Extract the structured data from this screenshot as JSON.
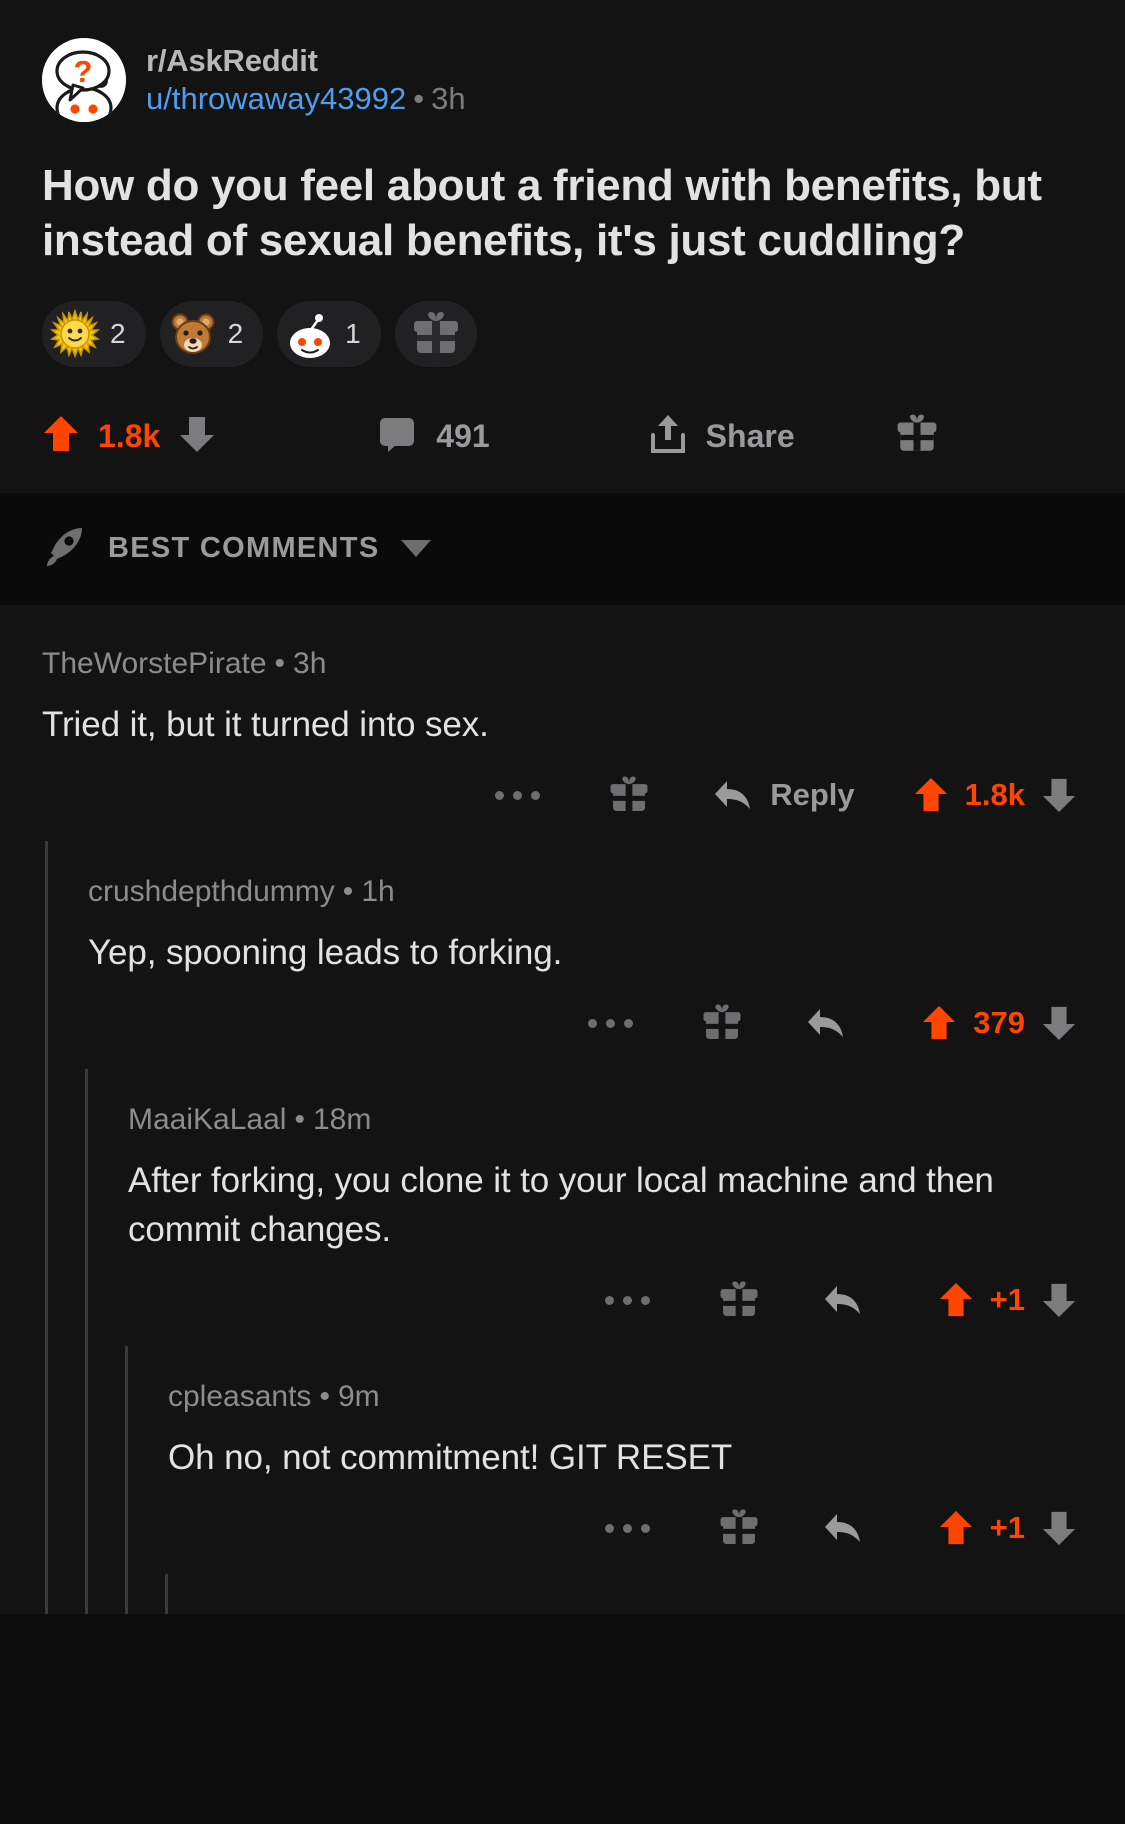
{
  "post": {
    "subreddit": "r/AskReddit",
    "author": "u/throwaway43992",
    "separator": "•",
    "age": "3h",
    "avatar_icon": "askreddit-snoo-avatar",
    "title": "How do you feel about a friend with benefits, but instead of sexual benefits, it's just cuddling?",
    "awards": [
      {
        "icon": "gold-starburst-face-award-icon",
        "count": "2"
      },
      {
        "icon": "bear-award-icon",
        "count": "2"
      },
      {
        "icon": "snoo-award-icon",
        "count": "1"
      },
      {
        "icon": "give-award-gift-icon",
        "count": ""
      }
    ],
    "actions": {
      "upvote_icon": "upvote-arrow-icon",
      "score": "1.8k",
      "downvote_icon": "downvote-arrow-icon",
      "comment_icon": "comment-bubble-icon",
      "comment_count": "491",
      "share_icon": "share-arrow-icon",
      "share_label": "Share",
      "gift_icon": "gift-icon"
    }
  },
  "sort": {
    "icon": "rocket-icon",
    "label": "BEST COMMENTS",
    "caret_icon": "chevron-down-icon"
  },
  "comments": [
    {
      "author": "TheWorstePirate",
      "separator": "•",
      "age": "3h",
      "body": "Tried it, but it turned into sex.",
      "more_icon": "overflow-dots-icon",
      "gift_icon": "gift-icon",
      "reply_icon": "reply-arrow-icon",
      "reply_label": "Reply",
      "upvote_icon": "upvote-arrow-icon",
      "score": "1.8k",
      "downvote_icon": "downvote-arrow-icon"
    },
    {
      "author": "crushdepthdummy",
      "separator": "•",
      "age": "1h",
      "body": "Yep, spooning leads to forking.",
      "more_icon": "overflow-dots-icon",
      "gift_icon": "gift-icon",
      "reply_icon": "reply-arrow-icon",
      "reply_label": "",
      "upvote_icon": "upvote-arrow-icon",
      "score": "379",
      "downvote_icon": "downvote-arrow-icon"
    },
    {
      "author": "MaaiKaLaal",
      "separator": "•",
      "age": "18m",
      "body": "After forking, you clone it to your local machine and then commit changes.",
      "more_icon": "overflow-dots-icon",
      "gift_icon": "gift-icon",
      "reply_icon": "reply-arrow-icon",
      "reply_label": "",
      "upvote_icon": "upvote-arrow-icon",
      "score": "+1",
      "downvote_icon": "downvote-arrow-icon"
    },
    {
      "author": "cpleasants",
      "separator": "•",
      "age": "9m",
      "body": "Oh no, not commitment! GIT RESET",
      "more_icon": "overflow-dots-icon",
      "gift_icon": "gift-icon",
      "reply_icon": "reply-arrow-icon",
      "reply_label": "",
      "upvote_icon": "upvote-arrow-icon",
      "score": "+1",
      "downvote_icon": "downvote-arrow-icon"
    }
  ],
  "colors": {
    "upvote_orange": "#ff4500",
    "link_blue": "#4f9eed",
    "background": "#131314",
    "sortbar_background": "#0a0a0a",
    "text_primary": "#e2e2e3",
    "text_muted": "#8c8c8e"
  }
}
